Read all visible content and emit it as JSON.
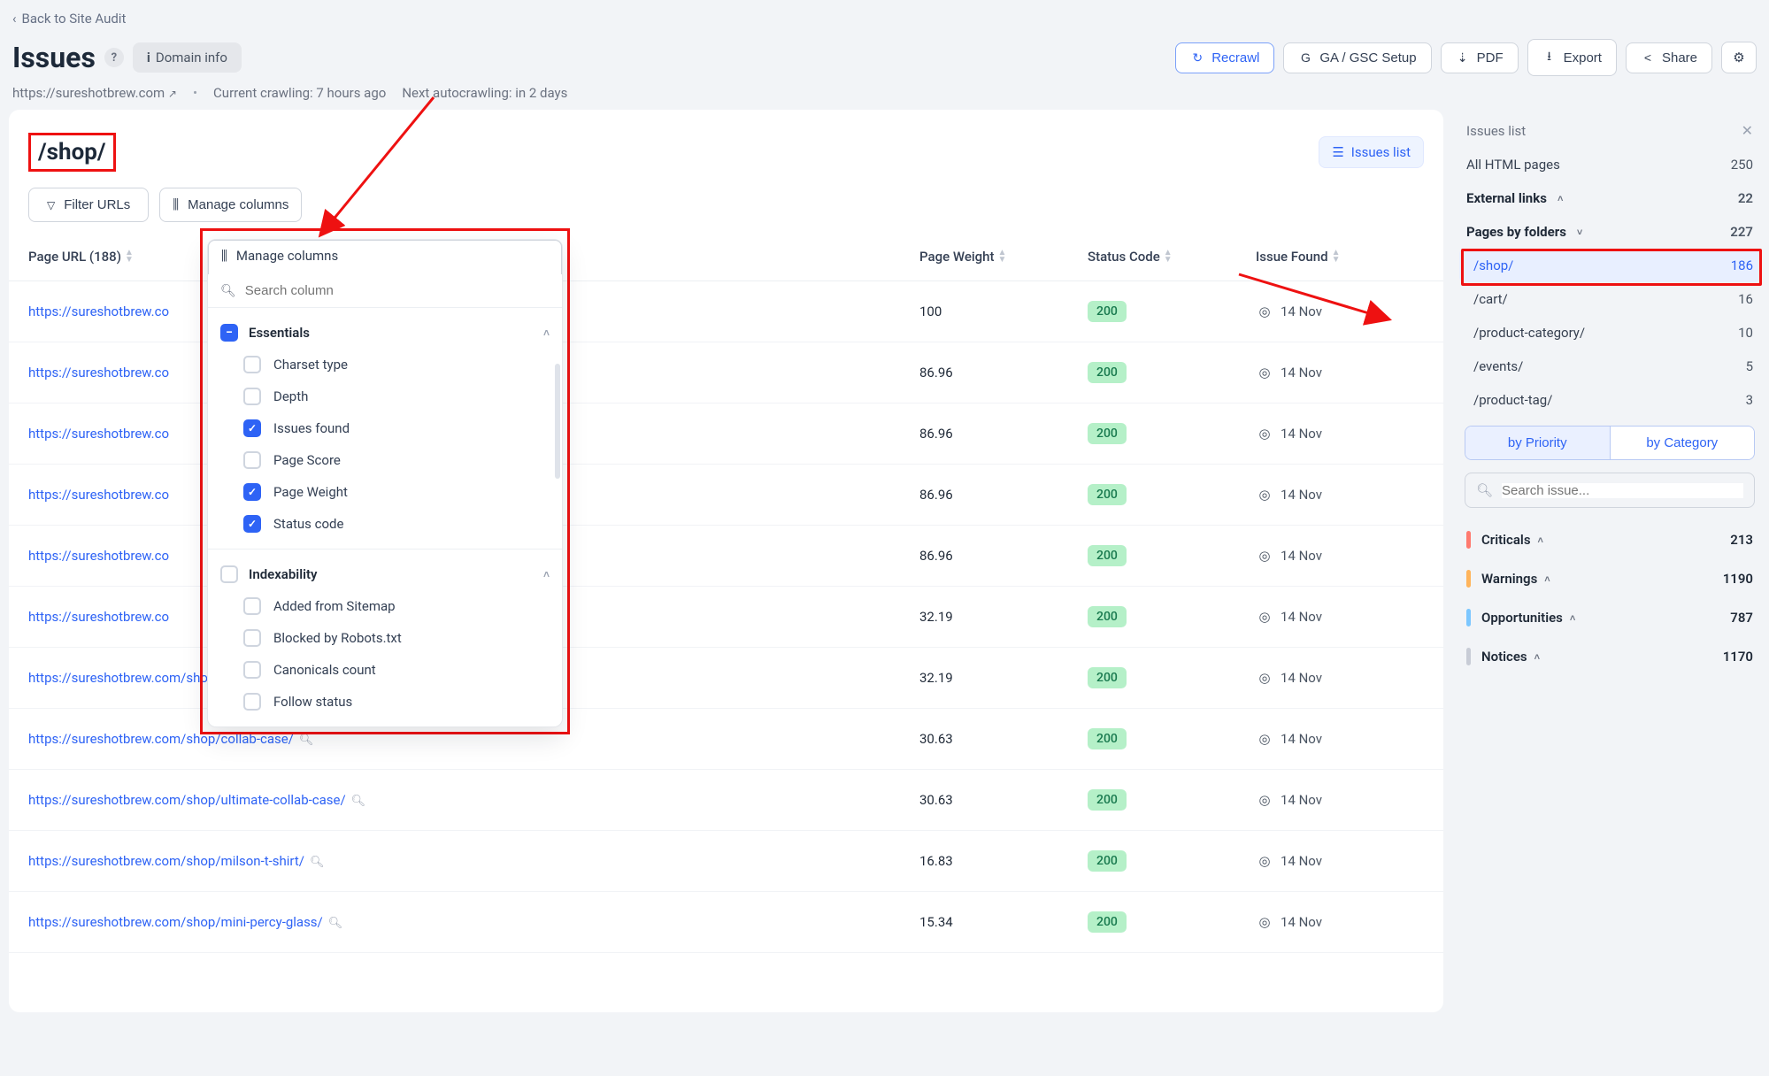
{
  "back_link": "Back to Site Audit",
  "page_title": "Issues",
  "domain_chip": {
    "icon": "i",
    "label": "Domain info"
  },
  "toolbar": {
    "recrawl": "Recrawl",
    "ga_gsc": "GA / GSC Setup",
    "pdf": "PDF",
    "export": "Export",
    "share": "Share"
  },
  "meta": {
    "domain_url": "https://sureshotbrew.com",
    "crawl_label": "Current crawling: 7 hours ago",
    "autocrawl_label": "Next autocrawling: in 2 days"
  },
  "folder_title": "/shop/",
  "issues_list_btn": "Issues list",
  "filter_urls_btn": "Filter URLs",
  "manage_columns_btn": "Manage columns",
  "column_manager": {
    "search_placeholder": "Search column",
    "groups": [
      {
        "name": "Essentials",
        "state": "indeterminate",
        "items": [
          {
            "label": "Charset type",
            "checked": false
          },
          {
            "label": "Depth",
            "checked": false
          },
          {
            "label": "Issues found",
            "checked": true
          },
          {
            "label": "Page Score",
            "checked": false
          },
          {
            "label": "Page Weight",
            "checked": true
          },
          {
            "label": "Status code",
            "checked": true
          }
        ]
      },
      {
        "name": "Indexability",
        "state": "unchecked",
        "items": [
          {
            "label": "Added from Sitemap",
            "checked": false
          },
          {
            "label": "Blocked by Robots.txt",
            "checked": false
          },
          {
            "label": "Canonicals count",
            "checked": false
          },
          {
            "label": "Follow status",
            "checked": false
          }
        ]
      }
    ]
  },
  "table": {
    "headers": {
      "url": "Page URL (188)",
      "weight": "Page Weight",
      "status": "Status Code",
      "issue": "Issue Found"
    },
    "rows": [
      {
        "url": "https://sureshotbrew.co",
        "weight": "100",
        "status": "200",
        "issue": "14 Nov",
        "truncated": true
      },
      {
        "url": "https://sureshotbrew.co",
        "weight": "86.96",
        "status": "200",
        "issue": "14 Nov",
        "truncated": true
      },
      {
        "url": "https://sureshotbrew.co",
        "weight": "86.96",
        "status": "200",
        "issue": "14 Nov",
        "truncated": true
      },
      {
        "url": "https://sureshotbrew.co",
        "weight": "86.96",
        "status": "200",
        "issue": "14 Nov",
        "truncated": true
      },
      {
        "url": "https://sureshotbrew.co",
        "weight": "86.96",
        "status": "200",
        "issue": "14 Nov",
        "truncated": true
      },
      {
        "url": "https://sureshotbrew.co",
        "weight": "32.19",
        "status": "200",
        "issue": "14 Nov",
        "truncated": true
      },
      {
        "url": "https://sureshotbrew.com/shop/land-of-arches/",
        "weight": "32.19",
        "status": "200",
        "issue": "14 Nov"
      },
      {
        "url": "https://sureshotbrew.com/shop/collab-case/",
        "weight": "30.63",
        "status": "200",
        "issue": "14 Nov"
      },
      {
        "url": "https://sureshotbrew.com/shop/ultimate-collab-case/",
        "weight": "30.63",
        "status": "200",
        "issue": "14 Nov"
      },
      {
        "url": "https://sureshotbrew.com/shop/milson-t-shirt/",
        "weight": "16.83",
        "status": "200",
        "issue": "14 Nov"
      },
      {
        "url": "https://sureshotbrew.com/shop/mini-percy-glass/",
        "weight": "15.34",
        "status": "200",
        "issue": "14 Nov"
      }
    ]
  },
  "sidepanel": {
    "title": "Issues list",
    "all_html": {
      "label": "All HTML pages",
      "value": "250"
    },
    "external": {
      "label": "External links",
      "value": "22"
    },
    "pages_by_folders": {
      "label": "Pages by folders",
      "value": "227"
    },
    "folders": [
      {
        "label": "/shop/",
        "value": "186",
        "selected": true
      },
      {
        "label": "/cart/",
        "value": "16"
      },
      {
        "label": "/product-category/",
        "value": "10"
      },
      {
        "label": "/events/",
        "value": "5"
      },
      {
        "label": "/product-tag/",
        "value": "3"
      }
    ],
    "seg": {
      "priority": "by Priority",
      "category": "by Category"
    },
    "search_placeholder": "Search issue...",
    "severities": [
      {
        "label": "Criticals",
        "value": "213",
        "color": "#ff7a6f"
      },
      {
        "label": "Warnings",
        "value": "1190",
        "color": "#ffb45b"
      },
      {
        "label": "Opportunities",
        "value": "787",
        "color": "#7cc7ff"
      },
      {
        "label": "Notices",
        "value": "1170",
        "color": "#c8ccd6"
      }
    ]
  }
}
